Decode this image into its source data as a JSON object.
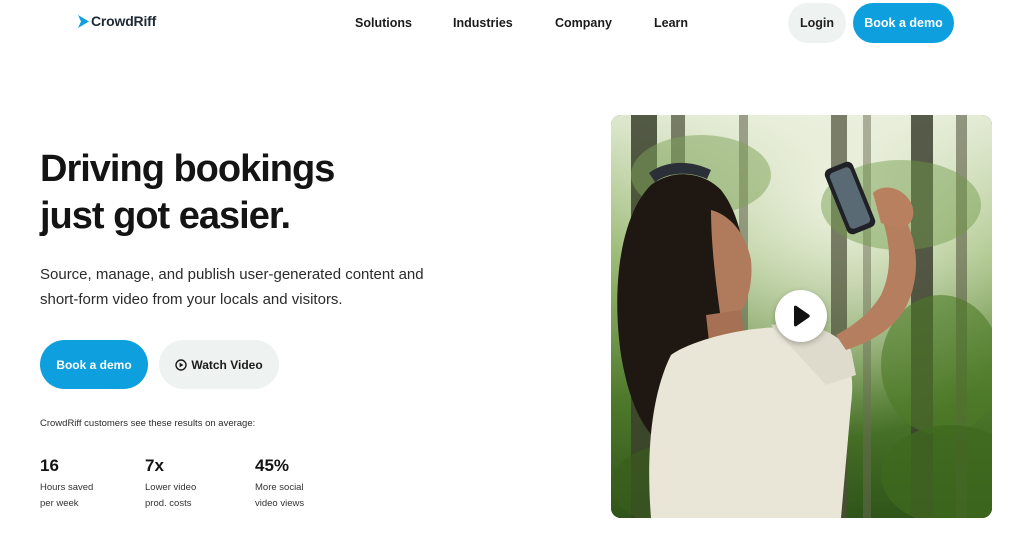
{
  "brand": {
    "name": "CrowdRiff",
    "color": "#0e9fdf"
  },
  "nav": {
    "links": [
      "Solutions",
      "Industries",
      "Company",
      "Learn"
    ],
    "login_label": "Login",
    "demo_label": "Book a demo"
  },
  "hero": {
    "headline_line1": "Driving bookings",
    "headline_line2": "just got easier.",
    "subtext": "Source, manage, and publish user-generated content and short-form video from your locals and visitors.",
    "primary_cta": "Book a demo",
    "secondary_cta": "Watch Video",
    "secondary_cta_icon": "play-circle-icon",
    "results_caption": "CrowdRiff customers see these results on average:",
    "stats": [
      {
        "value": "16",
        "label_line1": "Hours saved",
        "label_line2": "per week"
      },
      {
        "value": "7x",
        "label_line1": "Lower video",
        "label_line2": "prod. costs"
      },
      {
        "value": "45%",
        "label_line1": "More social",
        "label_line2": "video views"
      }
    ]
  },
  "media": {
    "play_icon": "play-icon"
  }
}
